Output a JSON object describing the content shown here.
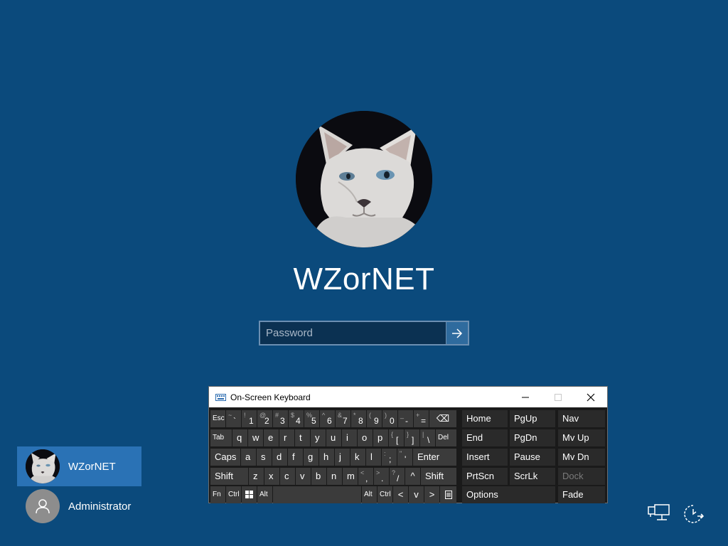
{
  "user": {
    "name": "WZorNET"
  },
  "password": {
    "placeholder": "Password",
    "value": ""
  },
  "icons": {
    "submit": "arrow-right-icon",
    "network": "network-icon",
    "ease_of_access": "ease-of-access-icon",
    "osk_app": "keyboard-icon"
  },
  "colors": {
    "background": "#0b4a7c",
    "selected_user": "#2a72b5",
    "password_box": "#0b3152"
  },
  "osk": {
    "title": "On-Screen Keyboard",
    "rows": [
      [
        {
          "main": "Esc"
        },
        {
          "shift": "~",
          "main": "`"
        },
        {
          "shift": "!",
          "main": "1"
        },
        {
          "shift": "@",
          "main": "2"
        },
        {
          "shift": "#",
          "main": "3"
        },
        {
          "shift": "$",
          "main": "4"
        },
        {
          "shift": "%",
          "main": "5"
        },
        {
          "shift": "^",
          "main": "6"
        },
        {
          "shift": "&",
          "main": "7"
        },
        {
          "shift": "*",
          "main": "8"
        },
        {
          "shift": "(",
          "main": "9"
        },
        {
          "shift": ")",
          "main": "0"
        },
        {
          "shift": "_",
          "main": "-"
        },
        {
          "shift": "+",
          "main": "="
        },
        {
          "main": "⌫"
        }
      ],
      [
        {
          "main": "Tab"
        },
        {
          "main": "q"
        },
        {
          "main": "w"
        },
        {
          "main": "e"
        },
        {
          "main": "r"
        },
        {
          "main": "t"
        },
        {
          "main": "y"
        },
        {
          "main": "u"
        },
        {
          "main": "i"
        },
        {
          "main": "o"
        },
        {
          "main": "p"
        },
        {
          "shift": "{",
          "main": "["
        },
        {
          "shift": "}",
          "main": "]"
        },
        {
          "shift": "|",
          "main": "\\"
        },
        {
          "main": "Del"
        }
      ],
      [
        {
          "main": "Caps"
        },
        {
          "main": "a"
        },
        {
          "main": "s"
        },
        {
          "main": "d"
        },
        {
          "main": "f"
        },
        {
          "main": "g"
        },
        {
          "main": "h"
        },
        {
          "main": "j"
        },
        {
          "main": "k"
        },
        {
          "main": "l"
        },
        {
          "shift": ":",
          "main": ";"
        },
        {
          "shift": "\"",
          "main": "'"
        },
        {
          "main": "Enter"
        }
      ],
      [
        {
          "main": "Shift"
        },
        {
          "main": "z"
        },
        {
          "main": "x"
        },
        {
          "main": "c"
        },
        {
          "main": "v"
        },
        {
          "main": "b"
        },
        {
          "main": "n"
        },
        {
          "main": "m"
        },
        {
          "shift": "<",
          "main": ","
        },
        {
          "shift": ">",
          "main": "."
        },
        {
          "shift": "?",
          "main": "/"
        },
        {
          "main": "^"
        },
        {
          "main": "Shift"
        }
      ],
      [
        {
          "main": "Fn"
        },
        {
          "main": "Ctrl"
        },
        {
          "main": "windows-key-icon"
        },
        {
          "main": "Alt"
        },
        {
          "main": ""
        },
        {
          "main": "Alt"
        },
        {
          "main": "Ctrl"
        },
        {
          "main": "<"
        },
        {
          "main": "v"
        },
        {
          "main": ">"
        },
        {
          "main": "menu-key-icon"
        }
      ]
    ],
    "nav_keys": [
      [
        "Home",
        "PgUp",
        "Nav"
      ],
      [
        "End",
        "PgDn",
        "Mv Up"
      ],
      [
        "Insert",
        "Pause",
        "Mv Dn"
      ],
      [
        "PrtScn",
        "ScrLk",
        "Dock"
      ],
      [
        "Options",
        "Fade"
      ]
    ],
    "disabled_keys": [
      "Dock"
    ]
  },
  "user_list": [
    {
      "name": "WZorNET",
      "selected": true
    },
    {
      "name": "Administrator",
      "selected": false
    }
  ]
}
